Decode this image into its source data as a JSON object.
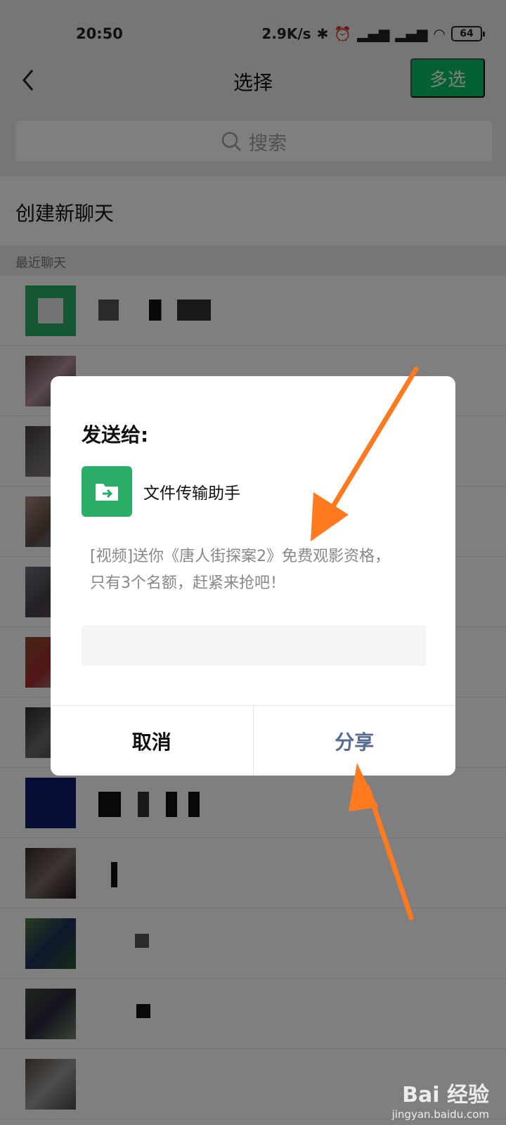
{
  "status_bar": {
    "time": "20:50",
    "speed": "2.9K/s",
    "battery": "64"
  },
  "nav": {
    "title": "选择",
    "multi_select": "多选"
  },
  "search": {
    "placeholder": "搜索"
  },
  "list": {
    "create_chat": "创建新聊天",
    "section_label": "最近聊天"
  },
  "dialog": {
    "title": "发送给:",
    "recipient_name": "文件传输助手",
    "message": "[视频]送你《唐人街探案2》免费观影资格，只有3个名额，赶紧来抢吧！",
    "input_value": "",
    "cancel_label": "取消",
    "share_label": "分享"
  },
  "colors": {
    "accent_green": "#07c160",
    "annotation_orange": "#ff7a1f",
    "share_blue": "#576b95"
  },
  "watermark": {
    "main": "Bai 经验",
    "sub": "jingyan.baidu.com"
  }
}
